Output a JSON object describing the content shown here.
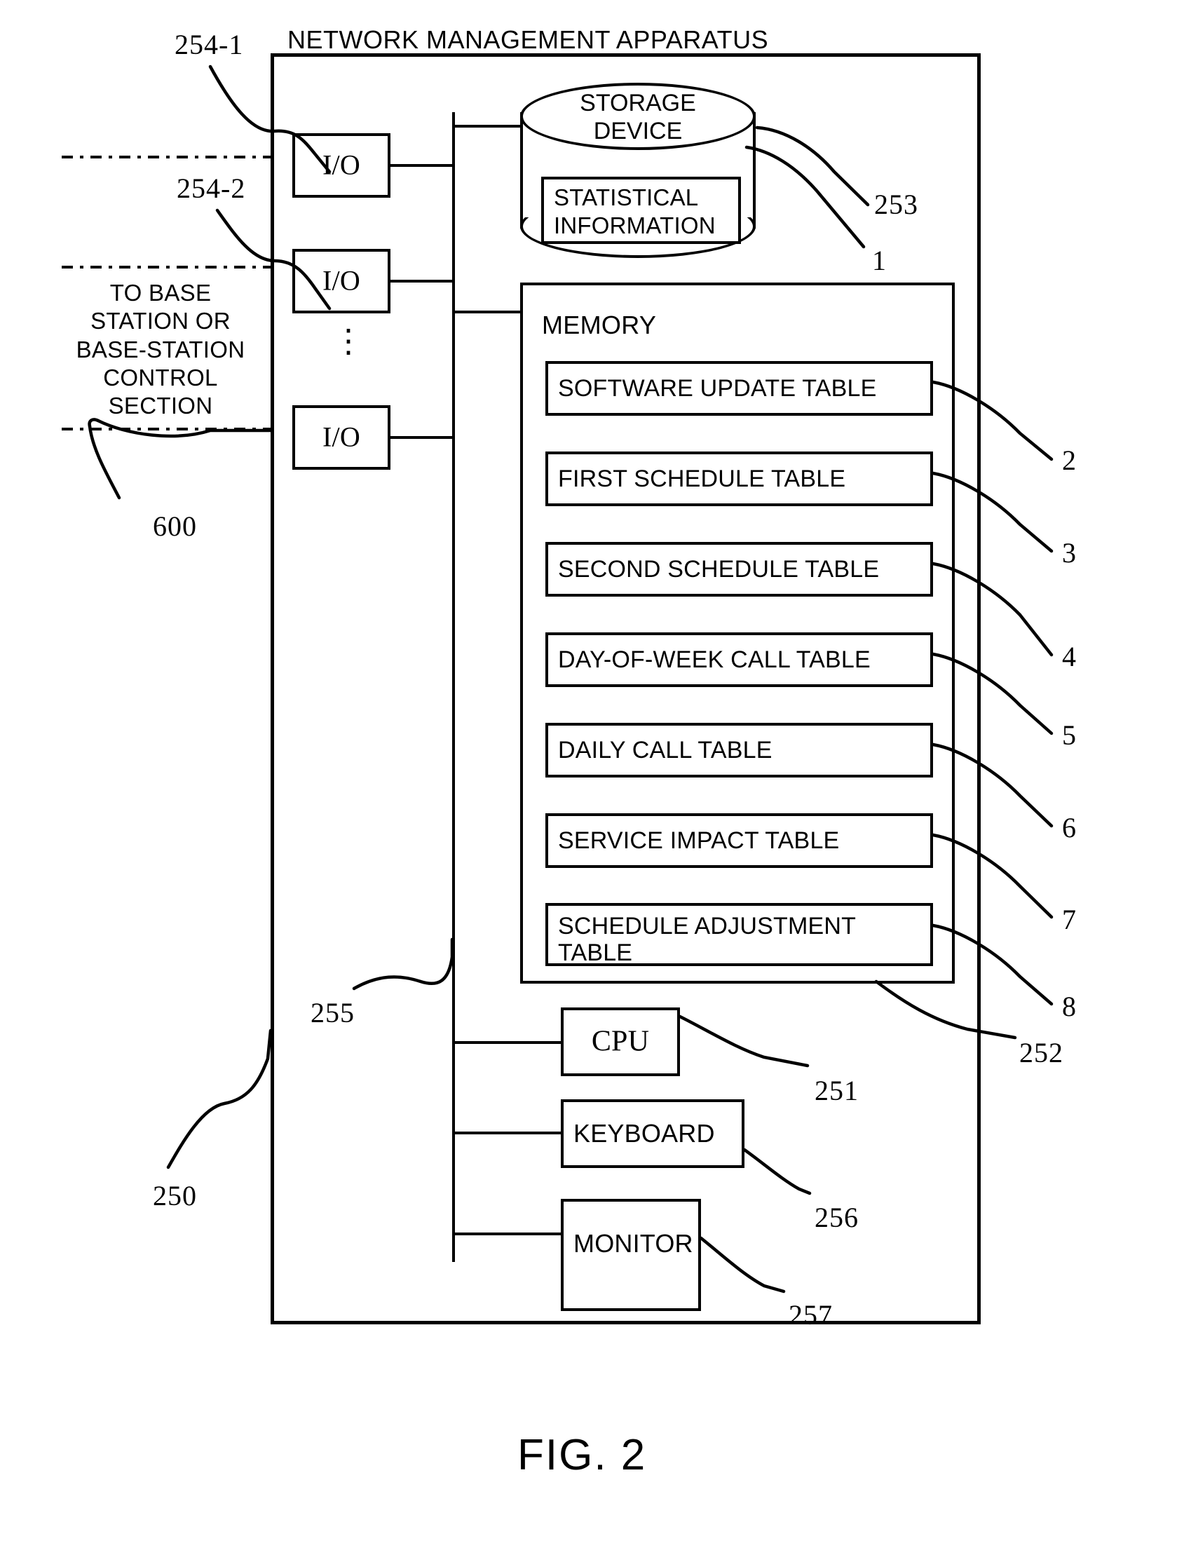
{
  "figure": {
    "caption": "FIG. 2",
    "title": "NETWORK MANAGEMENT APPARATUS"
  },
  "external": {
    "to_base_station_label": "TO BASE STATION OR BASE-STATION CONTROL SECTION",
    "apparatus_ref": "250",
    "network_ref": "600"
  },
  "io_ports": {
    "items": [
      {
        "label": "I/O",
        "ref": "254-1"
      },
      {
        "label": "I/O",
        "ref": "254-2"
      },
      {
        "label": "I/O",
        "ref": ""
      }
    ],
    "ellipsis": "⋮"
  },
  "bus": {
    "ref": "255"
  },
  "storage": {
    "title_line1": "STORAGE",
    "title_line2": "DEVICE",
    "ref": "253",
    "inner": {
      "line1": "STATISTICAL",
      "line2": "INFORMATION",
      "ref": "1"
    }
  },
  "memory": {
    "title": "MEMORY",
    "ref": "252",
    "tables": [
      {
        "label": "SOFTWARE UPDATE TABLE",
        "ref": "2"
      },
      {
        "label": "FIRST SCHEDULE TABLE",
        "ref": "3"
      },
      {
        "label": "SECOND SCHEDULE TABLE",
        "ref": "4"
      },
      {
        "label": "DAY-OF-WEEK CALL TABLE",
        "ref": "5"
      },
      {
        "label": "DAILY CALL TABLE",
        "ref": "6"
      },
      {
        "label": "SERVICE IMPACT TABLE",
        "ref": "7"
      },
      {
        "label": "SCHEDULE ADJUSTMENT TABLE",
        "ref": "8"
      }
    ]
  },
  "peripherals": [
    {
      "label": "CPU",
      "ref": "251"
    },
    {
      "label": "KEYBOARD",
      "ref": "256"
    },
    {
      "label": "MONITOR",
      "ref": "257"
    }
  ]
}
